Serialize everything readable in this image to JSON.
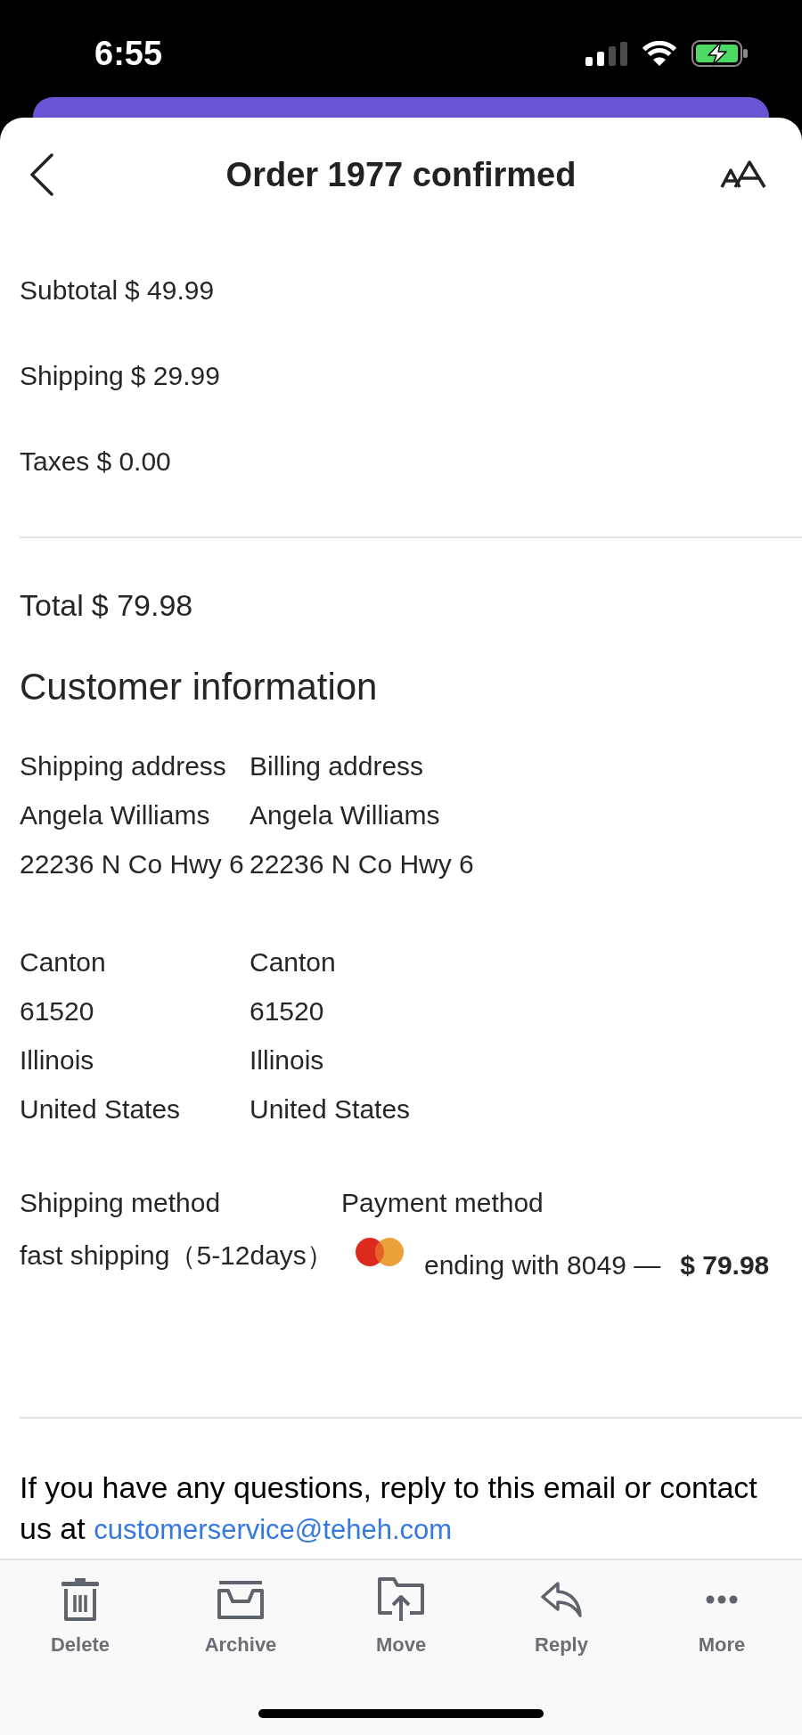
{
  "status_bar": {
    "time": "6:55"
  },
  "header": {
    "title": "Order 1977 confirmed"
  },
  "summary": {
    "lines": [
      {
        "label": "Subtotal",
        "amount": "$ 49.99"
      },
      {
        "label": "Shipping",
        "amount": "$ 29.99"
      },
      {
        "label": "Taxes",
        "amount": "$ 0.00"
      }
    ],
    "total": {
      "label": "Total",
      "amount": "$ 79.98"
    }
  },
  "customer_information": {
    "heading": "Customer information",
    "addresses": [
      {
        "heading": "Shipping address",
        "name": "Angela Williams",
        "street": "22236 N Co Hwy 6",
        "city": "Canton",
        "postal_code": "61520",
        "state": "Illinois",
        "country": "United States"
      },
      {
        "heading": "Billing address",
        "name": "Angela Williams",
        "street": "22236 N Co Hwy 6",
        "city": "Canton",
        "postal_code": "61520",
        "state": "Illinois",
        "country": "United States"
      }
    ]
  },
  "shipping_method": {
    "heading": "Shipping method",
    "value": "fast shipping（5-12days）"
  },
  "payment_method": {
    "heading": "Payment method",
    "card_ending": "ending with 8049 —",
    "amount": "$ 79.98"
  },
  "footer_note": {
    "text": "If you have any questions, reply to this email or contact us at",
    "link": "customerservice@teheh.com"
  },
  "toolbar": [
    {
      "label": "Delete",
      "kind": "delete"
    },
    {
      "label": "Archive",
      "kind": "archive"
    },
    {
      "label": "Move",
      "kind": "move"
    },
    {
      "label": "Reply",
      "kind": "reply"
    },
    {
      "label": "More",
      "kind": "more"
    }
  ]
}
